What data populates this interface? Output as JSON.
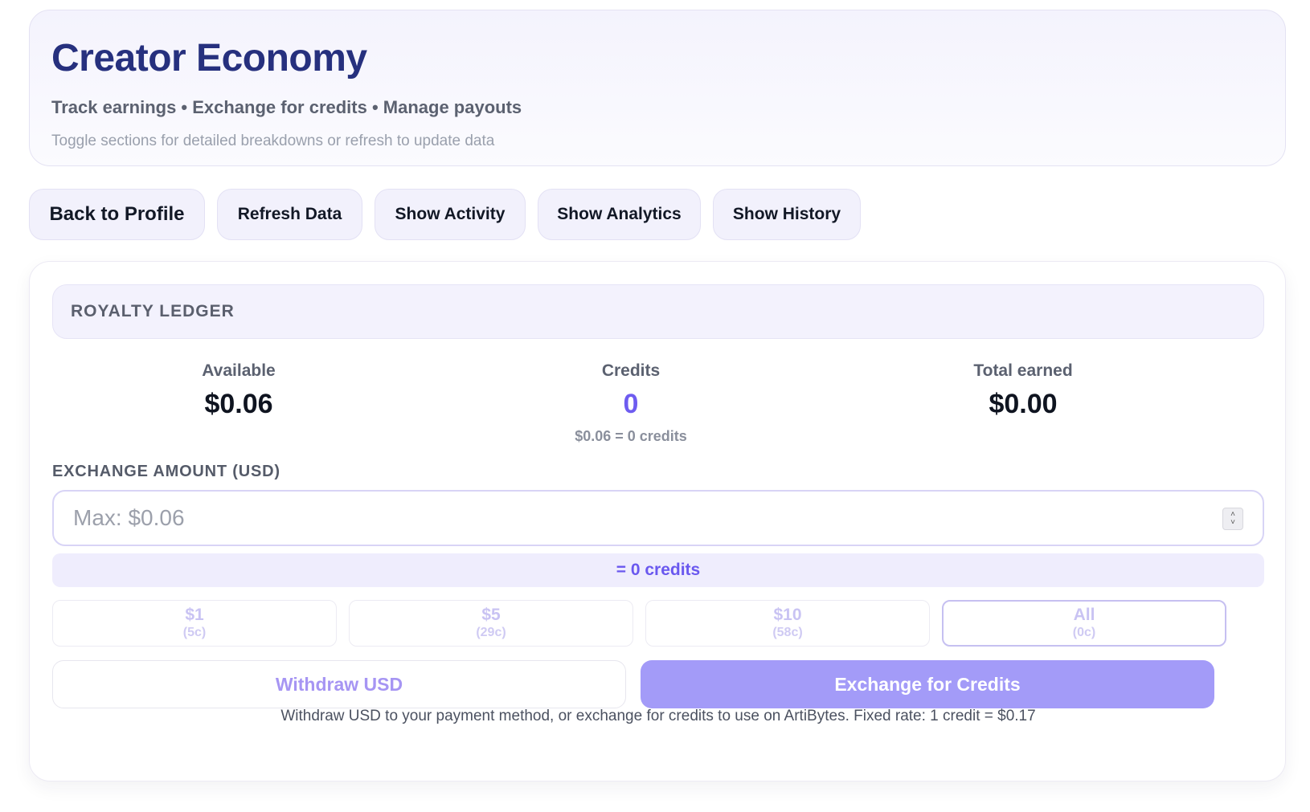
{
  "header": {
    "title": "Creator Economy",
    "subtitle": "Track earnings • Exchange for credits • Manage payouts",
    "hint": "Toggle sections for detailed breakdowns or refresh to update data"
  },
  "toolbar": {
    "back_label": "Back to Profile",
    "refresh_label": "Refresh Data",
    "activity_label": "Show Activity",
    "analytics_label": "Show Analytics",
    "history_label": "Show History"
  },
  "ledger": {
    "title": "ROYALTY LEDGER",
    "stats": {
      "available": {
        "label": "Available",
        "value": "$0.06"
      },
      "credits": {
        "label": "Credits",
        "value": "0",
        "note": "$0.06 = 0 credits"
      },
      "total": {
        "label": "Total earned",
        "value": "$0.00"
      }
    },
    "exchange": {
      "label": "EXCHANGE AMOUNT (USD)",
      "placeholder": "Max: $0.06",
      "value": "",
      "conversion": "= 0 credits"
    },
    "presets": [
      {
        "label": "$1",
        "sub": "(5c)",
        "selected": false
      },
      {
        "label": "$5",
        "sub": "(29c)",
        "selected": false
      },
      {
        "label": "$10",
        "sub": "(58c)",
        "selected": false
      },
      {
        "label": "All",
        "sub": "(0c)",
        "selected": true
      }
    ],
    "withdraw_label": "Withdraw USD",
    "exchange_label": "Exchange for Credits",
    "footer": "Withdraw USD to your payment method, or exchange for credits to use on ArtiBytes. Fixed rate: 1 credit = $0.17"
  },
  "colors": {
    "title": "#26307e",
    "accent": "#6e5cf0",
    "primary_button": "#a39bf8",
    "panel_bg": "#f3f2fd"
  }
}
